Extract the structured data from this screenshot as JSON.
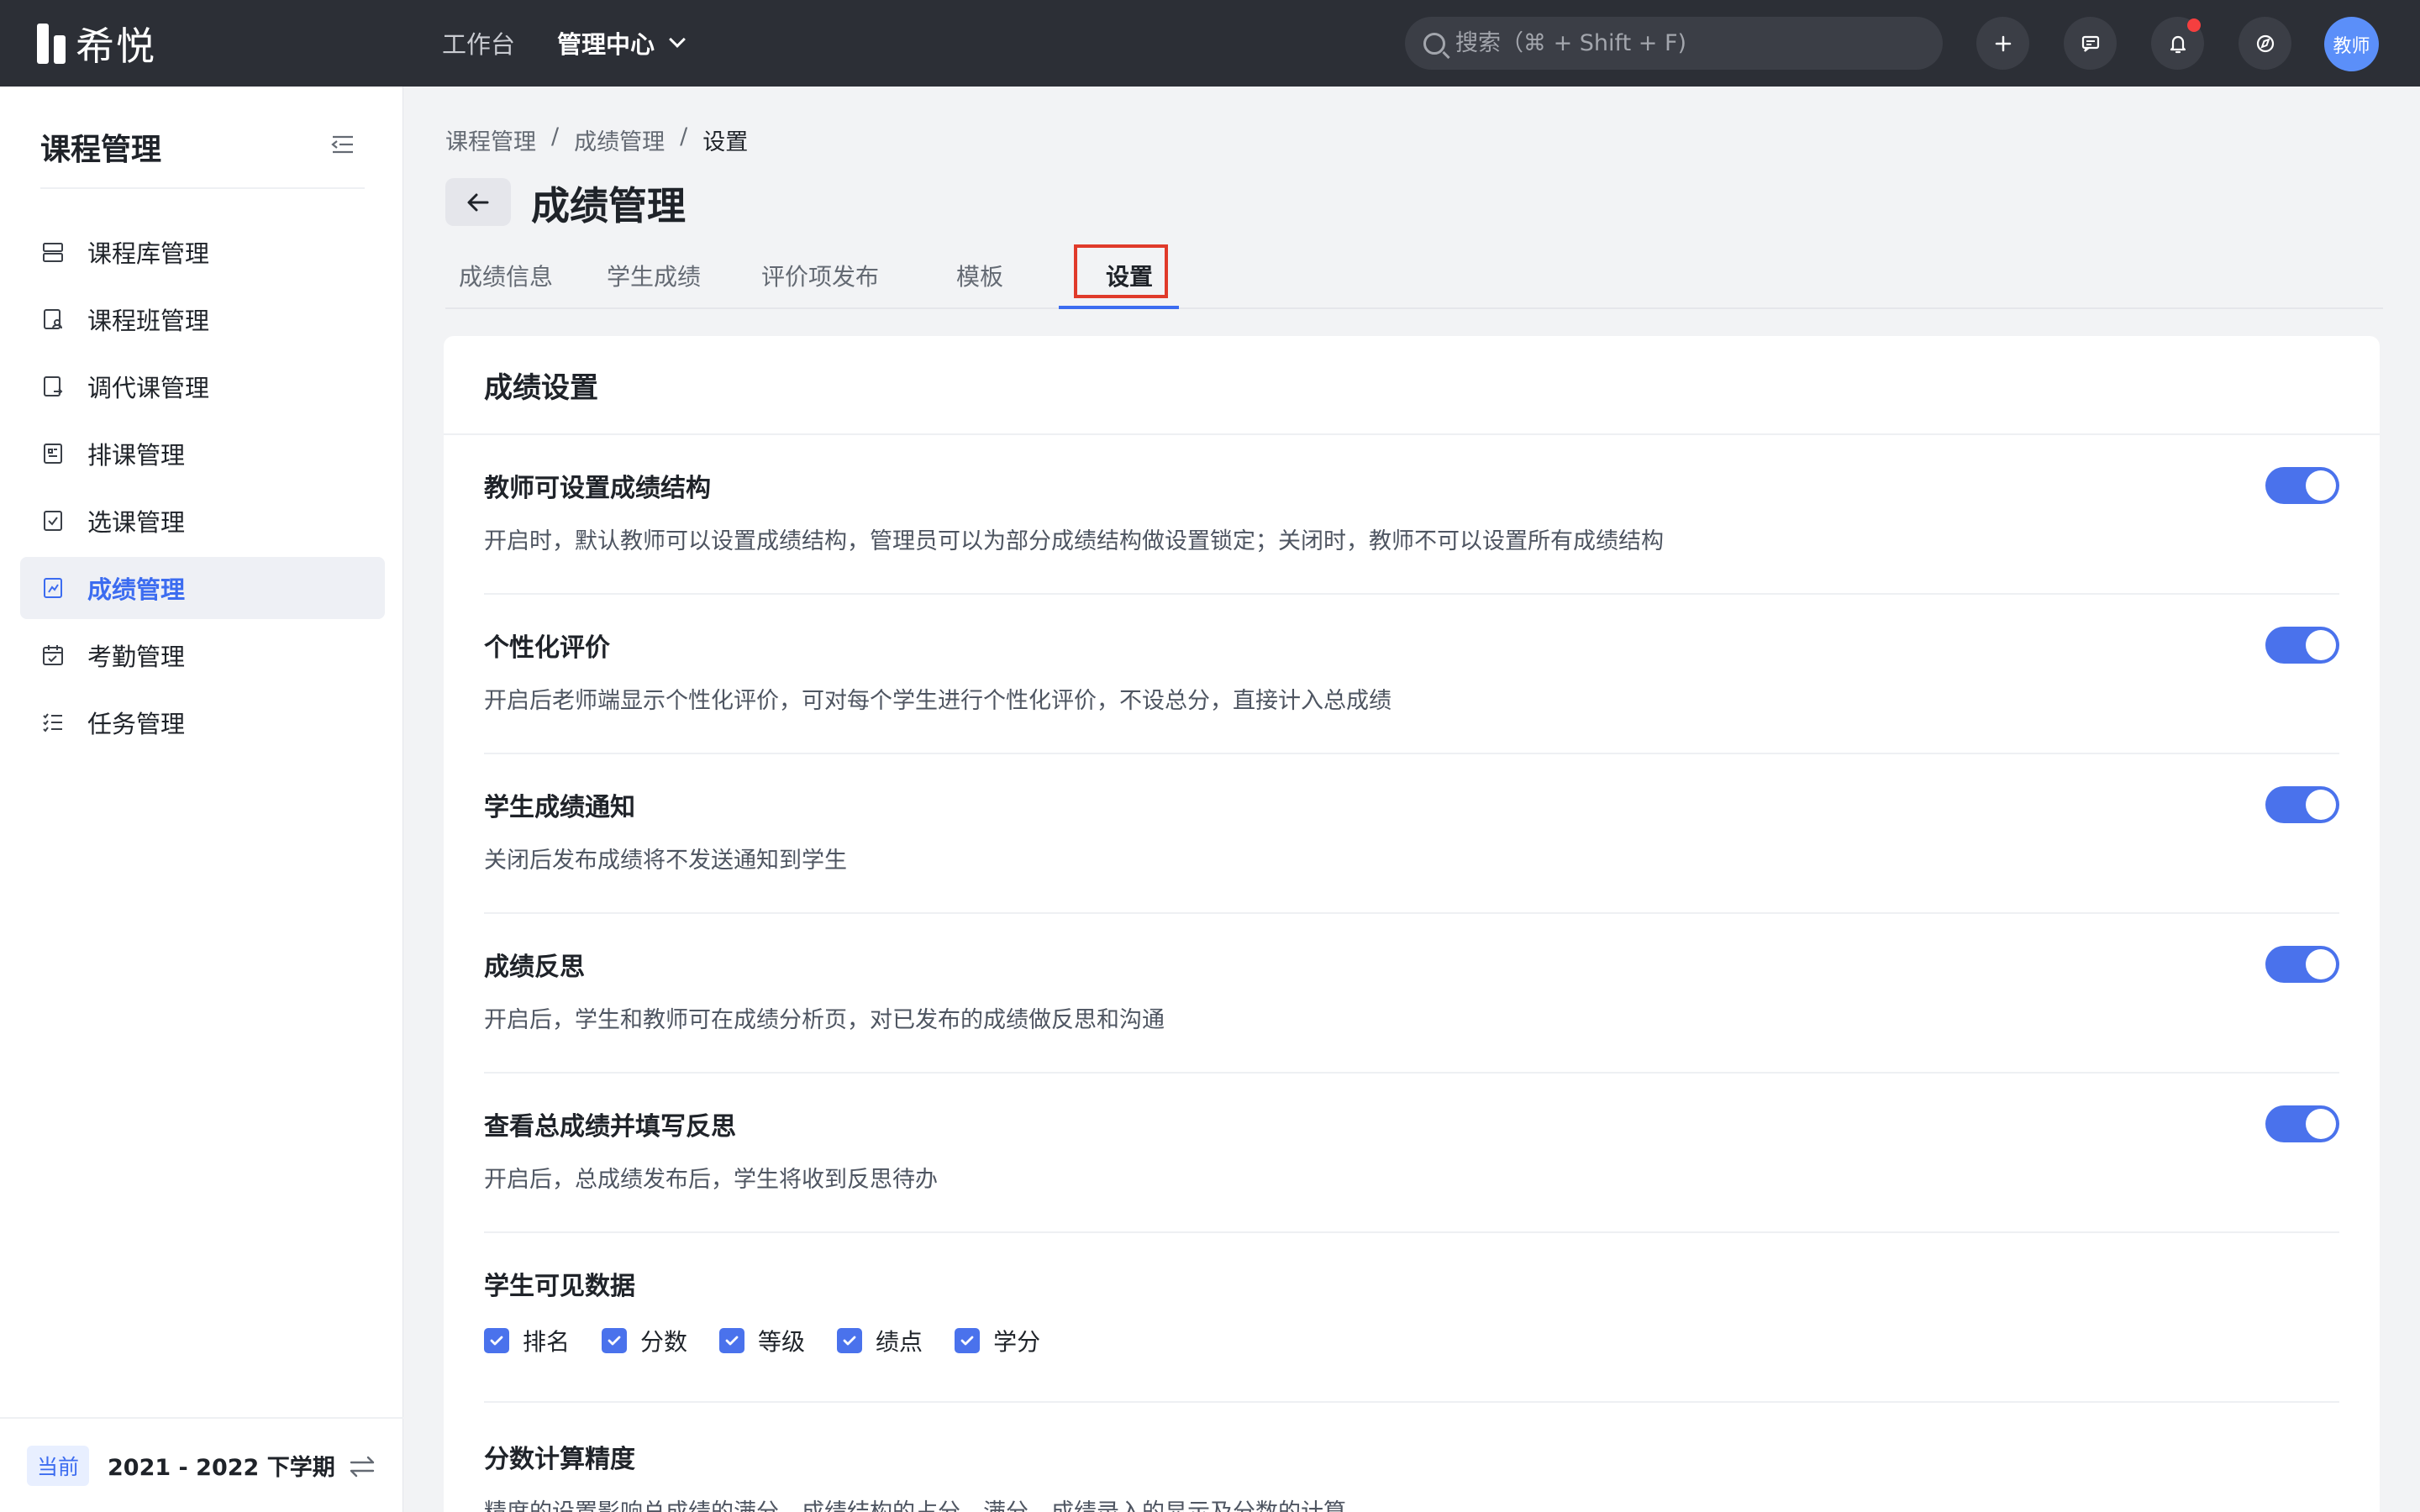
{
  "app": {
    "logo_text": "希悦"
  },
  "topnav": {
    "items": [
      "工作台",
      "管理中心"
    ]
  },
  "search": {
    "placeholder": "搜索（⌘ + Shift + F)"
  },
  "avatar": {
    "label": "教师"
  },
  "sidebar": {
    "title": "课程管理",
    "items": [
      {
        "label": "课程库管理",
        "icon": "course-library-icon"
      },
      {
        "label": "课程班管理",
        "icon": "course-class-icon"
      },
      {
        "label": "调代课管理",
        "icon": "substitute-icon"
      },
      {
        "label": "排课管理",
        "icon": "schedule-icon"
      },
      {
        "label": "选课管理",
        "icon": "select-course-icon"
      },
      {
        "label": "成绩管理",
        "icon": "grades-icon",
        "active": true
      },
      {
        "label": "考勤管理",
        "icon": "attendance-icon"
      },
      {
        "label": "任务管理",
        "icon": "tasks-icon"
      }
    ],
    "footer": {
      "tag": "当前",
      "term": "2021 - 2022 下学期"
    }
  },
  "breadcrumb": [
    "课程管理",
    "/",
    "成绩管理",
    "/",
    "设置"
  ],
  "page": {
    "title": "成绩管理"
  },
  "tabs": [
    "成绩信息",
    "学生成绩",
    "评价项发布",
    "模板",
    "设置"
  ],
  "card": {
    "title": "成绩设置",
    "settings": [
      {
        "title": "教师可设置成绩结构",
        "desc": "开启时，默认教师可以设置成绩结构，管理员可以为部分成绩结构做设置锁定；关闭时，教师不可以设置所有成绩结构",
        "enabled": true
      },
      {
        "title": "个性化评价",
        "desc": "开启后老师端显示个性化评价，可对每个学生进行个性化评价，不设总分，直接计入总成绩",
        "enabled": true
      },
      {
        "title": "学生成绩通知",
        "desc": "关闭后发布成绩将不发送通知到学生",
        "enabled": true
      },
      {
        "title": "成绩反思",
        "desc": "开启后，学生和教师可在成绩分析页，对已发布的成绩做反思和沟通",
        "enabled": true
      },
      {
        "title": "查看总成绩并填写反思",
        "desc": "开启后，总成绩发布后，学生将收到反思待办",
        "enabled": true
      }
    ],
    "visible_data": {
      "title": "学生可见数据",
      "options": [
        "排名",
        "分数",
        "等级",
        "绩点",
        "学分"
      ]
    },
    "precision": {
      "title": "分数计算精度",
      "desc": "精度的设置影响总成绩的满分、成绩结构的占分、满分、成绩录入的显示及分数的计算"
    }
  },
  "colors": {
    "accent": "#4a72ec",
    "topbar": "#2c2f36",
    "highlight": "#e03a2a"
  }
}
